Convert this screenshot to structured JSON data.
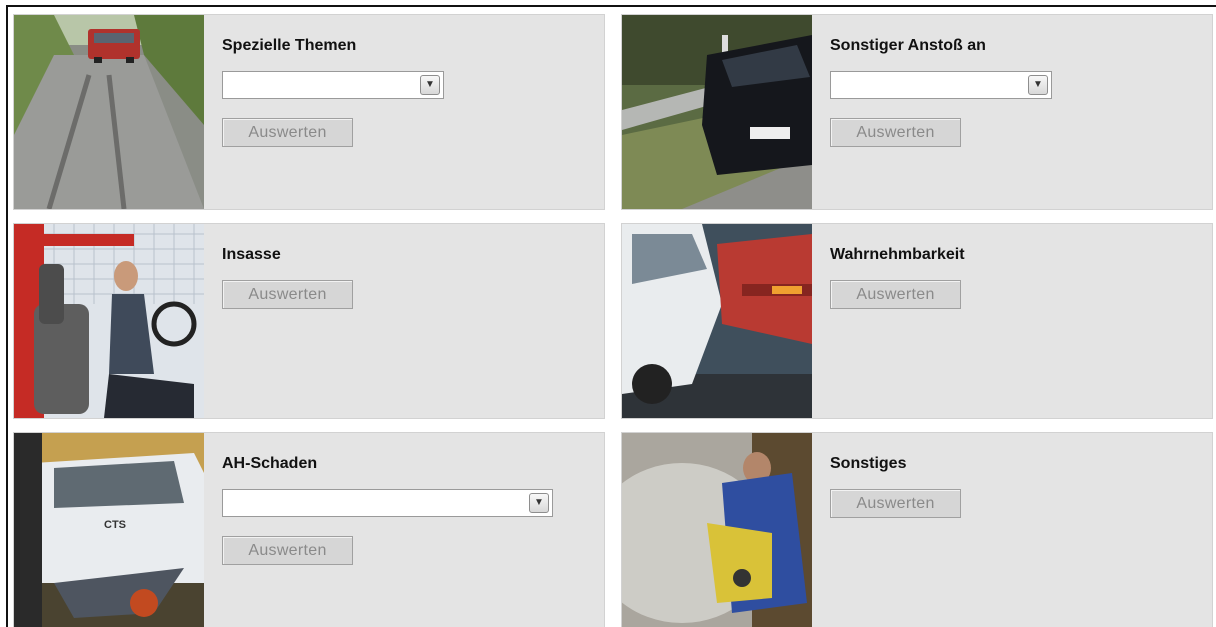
{
  "panels": [
    {
      "id": "spezielle-themen",
      "title": "Spezielle Themen",
      "has_select": true,
      "select_value": "",
      "button_label": "Auswerten",
      "photo": "car-on-road-skid-marks"
    },
    {
      "id": "sonstiger-anstoss",
      "title": "Sonstiger Anstoß an",
      "has_select": true,
      "select_value": "",
      "button_label": "Auswerten",
      "photo": "car-against-guardrail"
    },
    {
      "id": "insasse",
      "title": "Insasse",
      "has_select": false,
      "button_label": "Auswerten",
      "photo": "driver-in-seat"
    },
    {
      "id": "wahrnehmbarkeit",
      "title": "Wahrnehmbarkeit",
      "has_select": false,
      "button_label": "Auswerten",
      "photo": "car-collision"
    },
    {
      "id": "ah-schaden",
      "title": "AH-Schaden",
      "has_select": true,
      "select_value": "",
      "button_label": "Auswerten",
      "photo": "cts-car-wheelbarrow",
      "photo_text": "CTS"
    },
    {
      "id": "sonstiges",
      "title": "Sonstiges",
      "has_select": false,
      "button_label": "Auswerten",
      "photo": "worker-cutting-saw-dust"
    }
  ],
  "icons": {
    "select_arrow": "chevron-down-icon"
  },
  "colors": {
    "panel_bg": "#e4e4e4",
    "button_bg": "#d6d6d6",
    "button_text": "#8a8a8a"
  }
}
